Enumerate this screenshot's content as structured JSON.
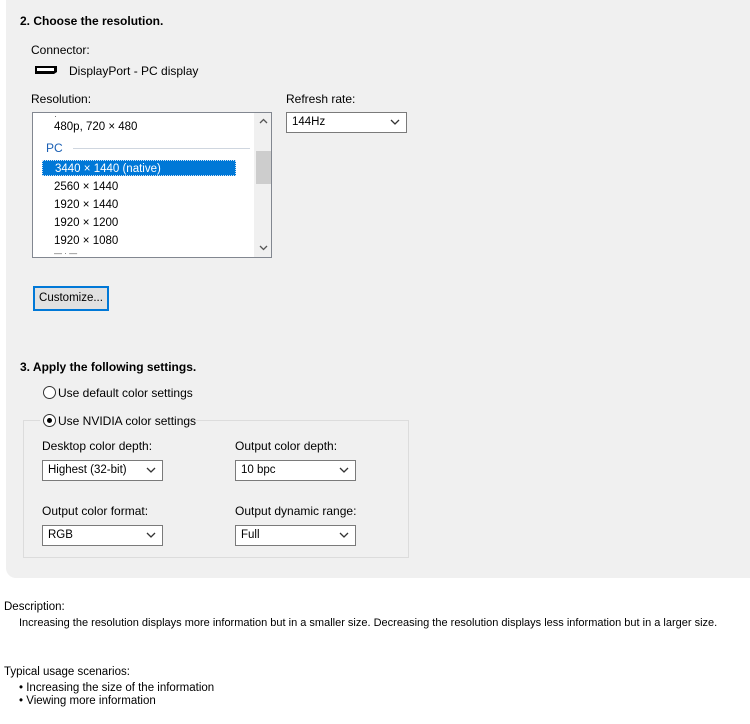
{
  "section2": {
    "title": "2. Choose the resolution.",
    "connector_label": "Connector:",
    "connector_value": "DisplayPort - PC display",
    "resolution_label": "Resolution:",
    "refresh_label": "Refresh rate:",
    "refresh_value": "144Hz",
    "resolutions": {
      "partial_top": "480p, 720 × 480",
      "group": "PC",
      "selected": "3440 × 1440 (native)",
      "r1": "2560 × 1440",
      "r2": "1920 × 1440",
      "r3": "1920 × 1200",
      "r4": "1920 × 1080"
    },
    "customize_label": "Customize..."
  },
  "section3": {
    "title": "3. Apply the following settings.",
    "radio_default": "Use default color settings",
    "radio_nvidia": "Use NVIDIA color settings",
    "selected_radio": "nvidia",
    "desktop_depth_label": "Desktop color depth:",
    "desktop_depth_value": "Highest (32-bit)",
    "output_depth_label": "Output color depth:",
    "output_depth_value": "10 bpc",
    "color_format_label": "Output color format:",
    "color_format_value": "RGB",
    "dynamic_range_label": "Output dynamic range:",
    "dynamic_range_value": "Full"
  },
  "description": {
    "label": "Description:",
    "text": "Increasing the resolution displays more information but in a smaller size. Decreasing the resolution displays less information but in a larger size."
  },
  "usage": {
    "label": "Typical usage scenarios:",
    "items": [
      "Increasing the size of the information",
      "Viewing more information"
    ]
  },
  "colors": {
    "panel_bg": "#f0f0f0",
    "selection": "#0078d7",
    "group_text": "#1a5fb4"
  }
}
